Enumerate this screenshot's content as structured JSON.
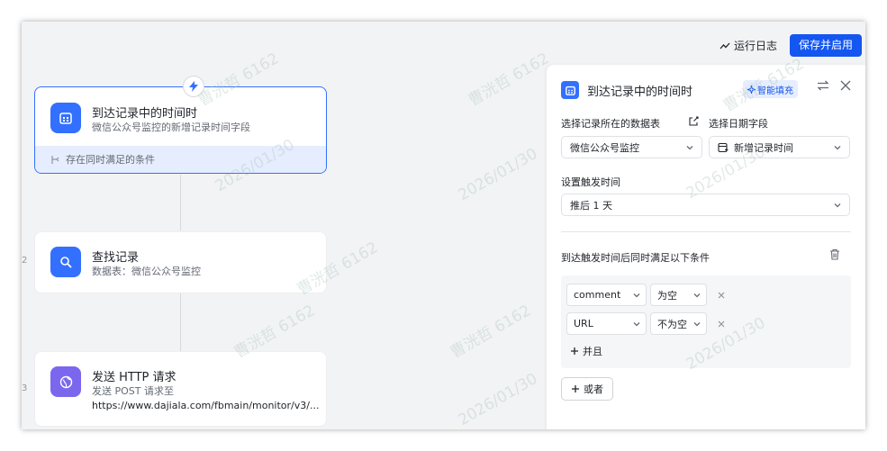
{
  "toolbar": {
    "run_log_label": "运行日志",
    "save_enable_label": "保存并启用"
  },
  "canvas": {
    "step_numbers": [
      "2",
      "3"
    ],
    "nodes": [
      {
        "title": "到达记录中的时间时",
        "subtitle": "微信公众号监控的新增记录时间字段",
        "footer": "存在同时满足的条件",
        "icon": "calendar-icon",
        "icon_color": "#3370ff"
      },
      {
        "title": "查找记录",
        "subtitle": "数据表：微信公众号监控",
        "icon": "search-icon",
        "icon_color": "#3370ff"
      },
      {
        "title": "发送 HTTP 请求",
        "subtitle": "发送 POST 请求至",
        "detail": "https://www.dajiala.com/fbmain/monitor/v3/...",
        "icon": "globe-icon",
        "icon_color": "#7b67ee"
      }
    ]
  },
  "panel": {
    "title": "到达记录中的时间时",
    "smart_fill_label": "智能填充",
    "table_label": "选择记录所在的数据表",
    "table_value": "微信公众号监控",
    "date_field_label": "选择日期字段",
    "date_field_value": "新增记录时间",
    "trigger_time_label": "设置触发时间",
    "trigger_time_value": "推后 1 天",
    "conditions_label": "到达触发时间后同时满足以下条件",
    "conditions": [
      {
        "field": "comment",
        "operator": "为空"
      },
      {
        "field": "URL",
        "operator": "不为空"
      }
    ],
    "and_label": "并且",
    "or_label": "或者"
  },
  "watermark": {
    "name": "曹洸哲 6162",
    "date": "2026/01/30"
  },
  "colors": {
    "primary": "#1456f0",
    "accent": "#3370ff",
    "http_icon": "#7b67ee"
  }
}
